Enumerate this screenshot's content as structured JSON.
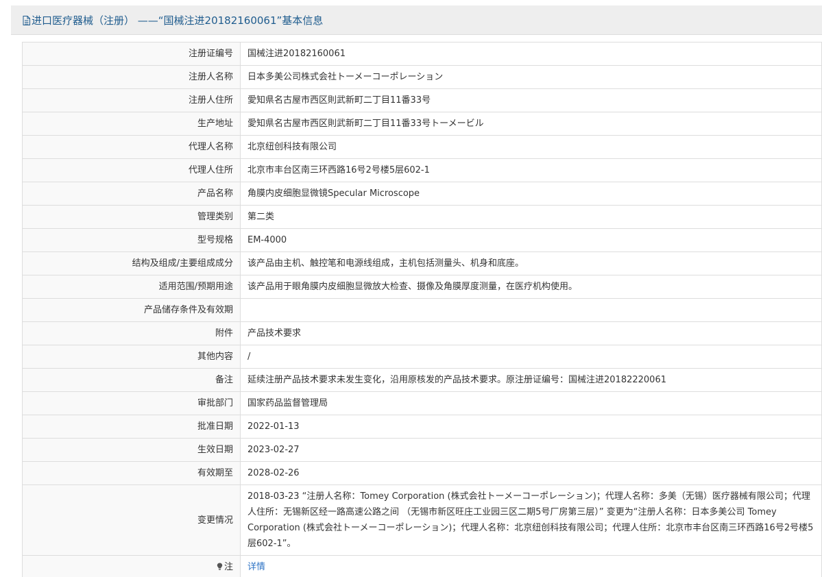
{
  "header": {
    "icon": "document-icon",
    "title": "进口医疗器械（注册） ——“国械注进20182160061”基本信息"
  },
  "rows": [
    {
      "label": "注册证编号",
      "value": "国械注进20182160061"
    },
    {
      "label": "注册人名称",
      "value": "日本多美公司株式会社トーメーコーポレーション"
    },
    {
      "label": "注册人住所",
      "value": "愛知県名古屋市西区則武新町二丁目11番33号"
    },
    {
      "label": "生产地址",
      "value": "愛知県名古屋市西区則武新町二丁目11番33号トーメービル"
    },
    {
      "label": "代理人名称",
      "value": "北京纽创科技有限公司"
    },
    {
      "label": "代理人住所",
      "value": "北京市丰台区南三环西路16号2号楼5层602-1"
    },
    {
      "label": "产品名称",
      "value": "角膜内皮细胞显微镜Specular Microscope"
    },
    {
      "label": "管理类别",
      "value": "第二类"
    },
    {
      "label": "型号规格",
      "value": "EM-4000"
    },
    {
      "label": "结构及组成/主要组成成分",
      "value": "该产品由主机、触控笔和电源线组成，主机包括测量头、机身和底座。"
    },
    {
      "label": "适用范围/预期用途",
      "value": "该产品用于眼角膜内皮细胞显微放大检查、摄像及角膜厚度测量，在医疗机构使用。"
    },
    {
      "label": "产品储存条件及有效期",
      "value": ""
    },
    {
      "label": "附件",
      "value": "产品技术要求"
    },
    {
      "label": "其他内容",
      "value": "/"
    },
    {
      "label": "备注",
      "value": "延续注册产品技术要求未发生变化，沿用原核发的产品技术要求。原注册证编号：国械注进20182220061"
    },
    {
      "label": "审批部门",
      "value": "国家药品监督管理局"
    },
    {
      "label": "批准日期",
      "value": "2022-01-13"
    },
    {
      "label": "生效日期",
      "value": "2023-02-27"
    },
    {
      "label": "有效期至",
      "value": "2028-02-26"
    }
  ],
  "change": {
    "label": "变更情况",
    "value": "2018-03-23 “注册人名称：Tomey Corporation (株式会社トーメーコーポレーション)；代理人名称：多美（无锡）医疗器械有限公司；代理人住所：无锡新区经一路高速公路之间 （无锡市新区旺庄工业园三区二期5号厂房第三层）” 变更为“注册人名称：日本多美公司 Tomey Corporation (株式会社トーメーコーポレーション)；代理人名称：北京纽创科技有限公司；代理人住所：北京市丰台区南三环西路16号2号楼5层602-1”。"
  },
  "note": {
    "icon": "lightbulb-icon",
    "label": "注",
    "link_text": "详情"
  },
  "colors": {
    "title": "#1f5c8e",
    "link": "#2f74c5",
    "header_bg": "#eeeeee",
    "label_bg": "#f9f9f9",
    "border": "#dddddd"
  }
}
